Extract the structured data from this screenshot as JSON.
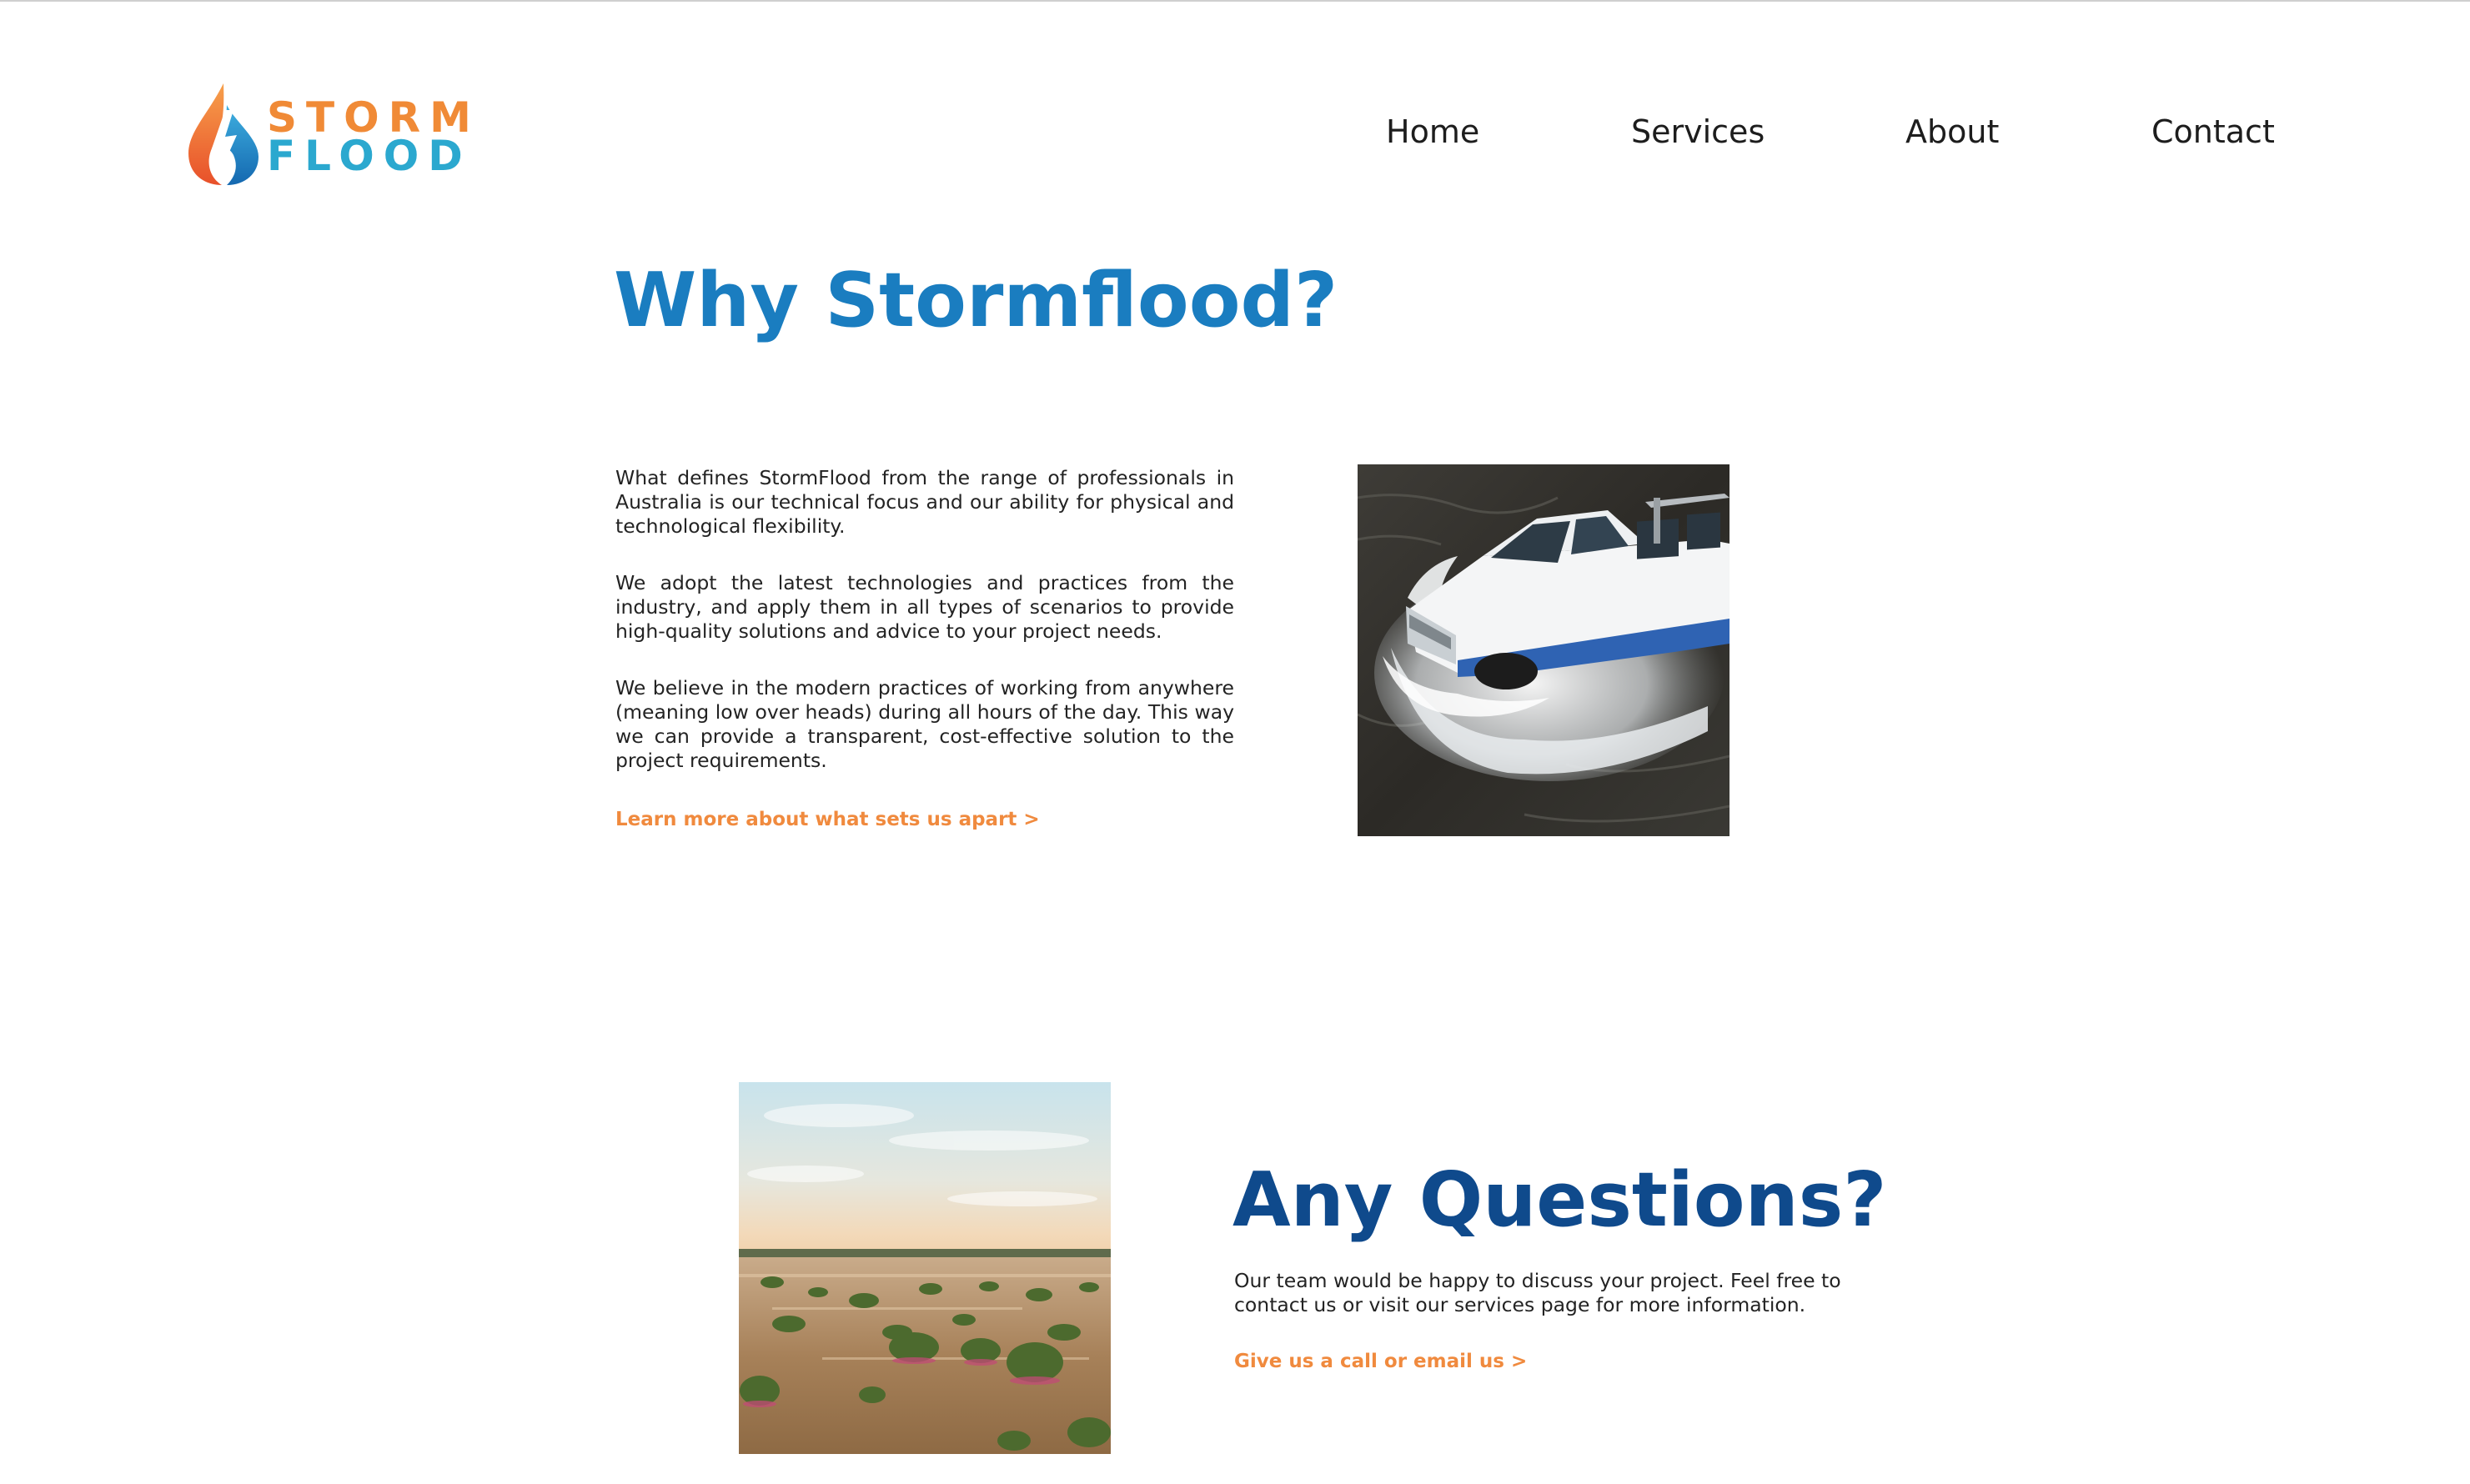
{
  "brand": {
    "logo_top": "STORM",
    "logo_bottom": "FLOOD",
    "logo_top_color": "#f08a36",
    "logo_bottom_color": "#2ba8cf"
  },
  "nav": {
    "items": [
      {
        "label": "Home"
      },
      {
        "label": "Services"
      },
      {
        "label": "About"
      },
      {
        "label": "Contact"
      }
    ]
  },
  "why": {
    "title": "Why Stormflood?",
    "title_color": "#1a7dc0",
    "paragraphs": [
      "What defines StormFlood from the range of professionals in Australia is our technical focus and our ability for physical and technological flexibility.",
      "We adopt the latest technologies and practices from the industry, and apply them in all types of scenarios to provide high-quality solutions and advice to your project needs.",
      "We believe in the modern practices of working from anywhere (meaning low over heads) during all hours of the day. This way we can provide a transparent, cost-effective solution to the project requirements."
    ],
    "link_label": "Learn more about what sets us apart >",
    "image": "truck-driving-through-floodwater-photo"
  },
  "questions": {
    "title": "Any Questions?",
    "title_color": "#0f4a8c",
    "text": "Our team would be happy to discuss your project. Feel free to contact us or visit our services page for more information.",
    "link_label": "Give us a call or email us >",
    "image": "flooded-landscape-at-sunset-photo"
  },
  "colors": {
    "accent_orange": "#f08a3e"
  }
}
